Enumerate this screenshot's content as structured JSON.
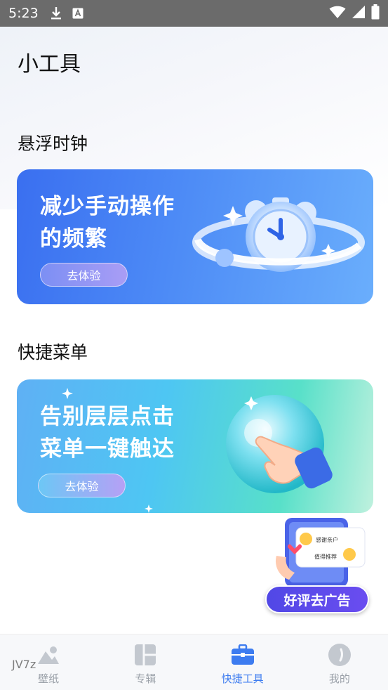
{
  "status_bar": {
    "time": "5:23",
    "icons": [
      "download-icon",
      "a-notification-icon",
      "wifi-icon",
      "signal-icon",
      "battery-icon"
    ]
  },
  "page": {
    "title": "小工具"
  },
  "sections": [
    {
      "title": "悬浮时钟",
      "card": {
        "heading_line1": "减少手动操作",
        "heading_line2": "的频繁",
        "button": "去体验",
        "art": "alarm-clock-icon"
      }
    },
    {
      "title": "快捷菜单",
      "card": {
        "heading_line1": "告别层层点击",
        "heading_line2": "菜单一键触达",
        "button": "去体验",
        "art": "tap-hand-icon"
      }
    }
  ],
  "floating_ad": {
    "phone_labels": [
      "感谢亲户",
      "值得推荐"
    ],
    "button": "好评去广告"
  },
  "bottom_nav": {
    "items": [
      {
        "label": "壁纸",
        "icon": "mountain-icon",
        "active": false
      },
      {
        "label": "专辑",
        "icon": "grid-icon",
        "active": false
      },
      {
        "label": "快捷工具",
        "icon": "toolbox-icon",
        "active": true
      },
      {
        "label": "我的",
        "icon": "profile-icon",
        "active": false
      }
    ]
  },
  "watermark": "JV7z",
  "colors": {
    "accent": "#3d7cf0",
    "nav_inactive": "#9aa0a8",
    "ad_button": "#5148e6"
  }
}
